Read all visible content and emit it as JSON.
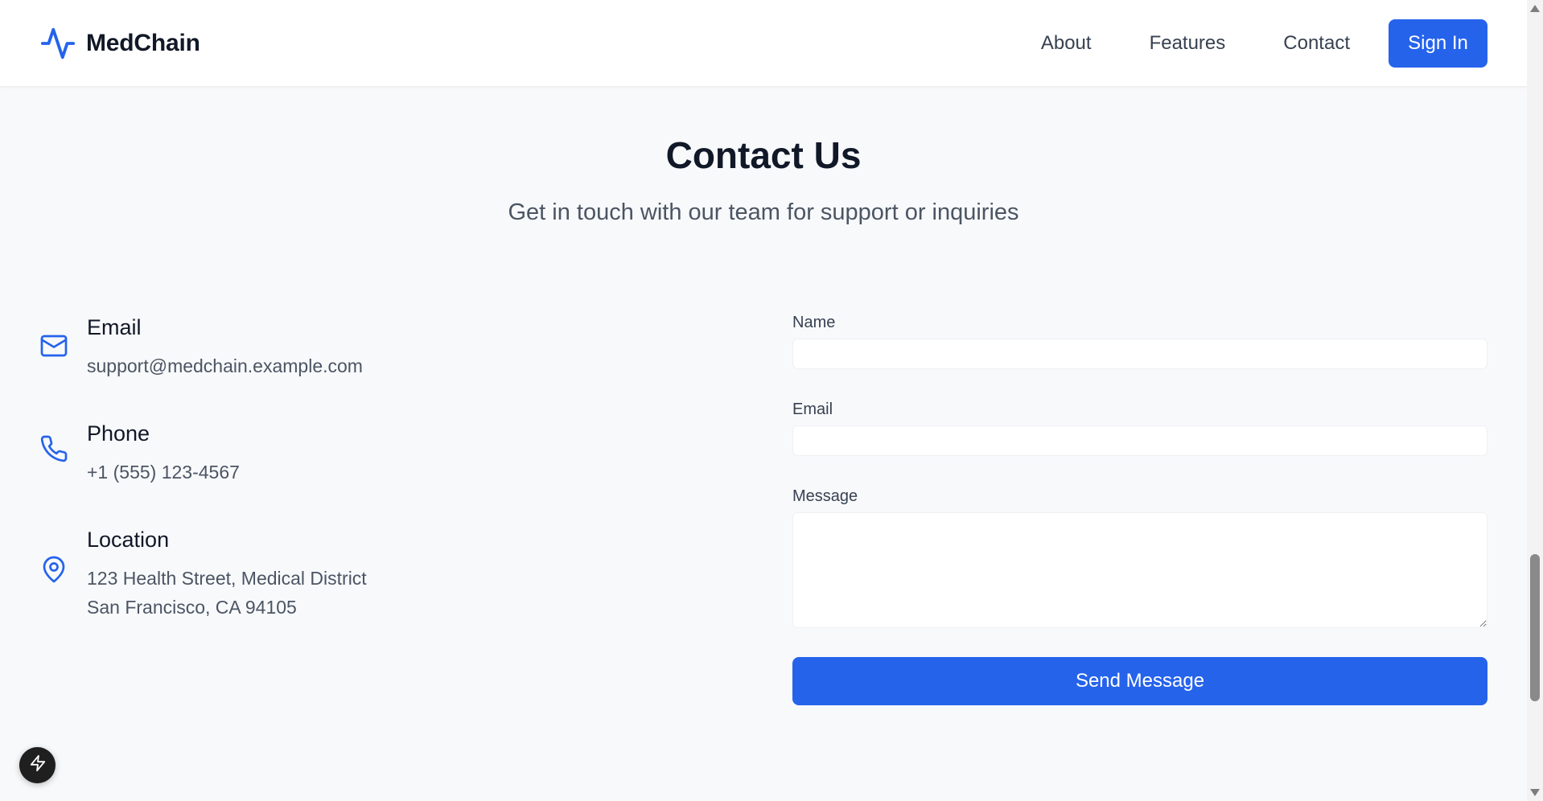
{
  "header": {
    "brand_name": "MedChain",
    "brand_icon": "activity-pulse-icon",
    "nav": {
      "about": "About",
      "features": "Features",
      "contact": "Contact"
    },
    "sign_in_label": "Sign In"
  },
  "section": {
    "title": "Contact Us",
    "subtitle": "Get in touch with our team for support or inquiries"
  },
  "contact_info": {
    "email": {
      "icon": "mail-icon",
      "title": "Email",
      "value": "support@medchain.example.com"
    },
    "phone": {
      "icon": "phone-icon",
      "title": "Phone",
      "value": "+1 (555) 123-4567"
    },
    "location": {
      "icon": "map-pin-icon",
      "title": "Location",
      "line1": "123 Health Street, Medical District",
      "line2": "San Francisco, CA 94105"
    }
  },
  "form": {
    "name_label": "Name",
    "name_value": "",
    "email_label": "Email",
    "email_value": "",
    "message_label": "Message",
    "message_value": "",
    "submit_label": "Send Message"
  },
  "colors": {
    "accent": "#2563eb",
    "background": "#f8f9fb",
    "heading": "#111827",
    "muted_text": "#4b5563"
  }
}
